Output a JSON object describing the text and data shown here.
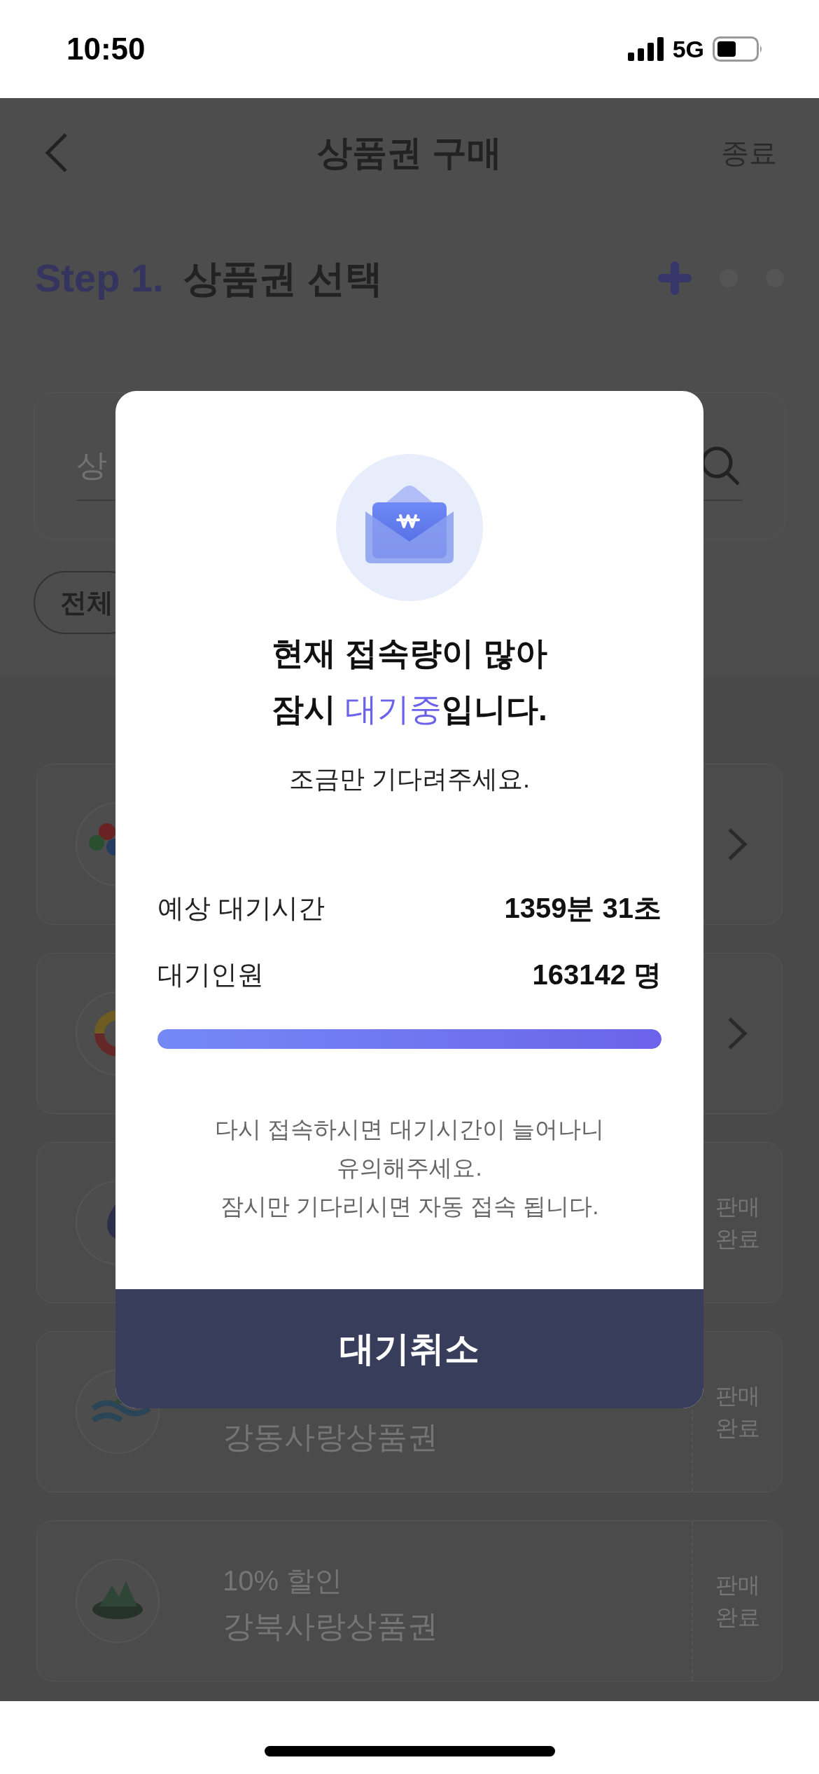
{
  "status_bar": {
    "time": "10:50",
    "network": "5G"
  },
  "header": {
    "title": "상품권 구매",
    "action": "종료"
  },
  "step": {
    "label": "Step 1.",
    "title": "상품권 선택",
    "steps": [
      {
        "selected": true
      },
      {
        "selected": false
      },
      {
        "selected": false
      }
    ]
  },
  "search": {
    "placeholder": "상"
  },
  "filters": [
    {
      "label": "전체"
    }
  ],
  "vouchers": [
    {
      "kind": "available"
    },
    {
      "kind": "available"
    },
    {
      "kind": "sold_out",
      "status": "판매 완료"
    },
    {
      "kind": "sold_out",
      "title": "강동사랑상품권",
      "status": "판매 완료"
    },
    {
      "kind": "sold_out",
      "discount": "10% 할인",
      "title": "강북사랑상품권",
      "status": "판매 완료"
    }
  ],
  "modal": {
    "title_lines": [
      [
        {
          "text": "현재 접속량이 많아",
          "highlight": false
        }
      ],
      [
        {
          "text": "잠시 ",
          "highlight": false
        },
        {
          "text": "대기중",
          "highlight": true
        },
        {
          "text": "입니다.",
          "highlight": false
        }
      ]
    ],
    "subtitle": "조금만 기다려주세요.",
    "rows": [
      {
        "label": "예상 대기시간",
        "value": "1359분 31초"
      },
      {
        "label": "대기인원",
        "value": "163142 명"
      }
    ],
    "progress": {
      "level": 1
    },
    "notice_lines": [
      "다시 접속하시면 대기시간이 늘어나니",
      "유의해주세요.",
      "잠시만 기다리시면 자동 접속 됩니다."
    ],
    "button": "대기취소"
  }
}
